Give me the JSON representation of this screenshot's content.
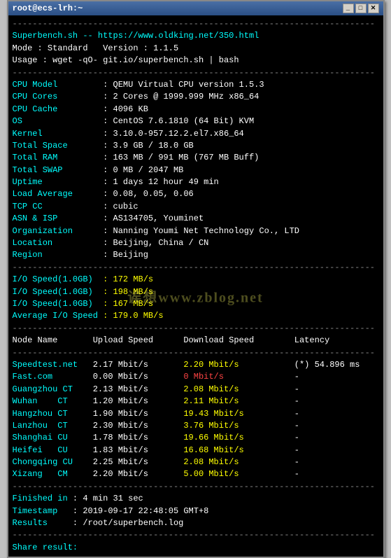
{
  "window": {
    "title": "root@ecs-lrh:~",
    "minimize_label": "_",
    "maximize_label": "□",
    "close_label": "✕"
  },
  "terminal": {
    "separator": "------------------------------------------------------------------------",
    "header": {
      "line1": "Superbench.sh -- https://www.oldking.net/350.html",
      "line2": "Mode : Standard   Version : 1.1.5",
      "line3": "Usage : wget -qO- git.io/superbench.sh | bash"
    },
    "system_info": [
      {
        "key": "CPU Model",
        "value": ": QEMU Virtual CPU version 1.5.3"
      },
      {
        "key": "CPU Cores",
        "value": ": 2 Cores @ 1999.999 MHz x86_64"
      },
      {
        "key": "CPU Cache",
        "value": ": 4096 KB"
      },
      {
        "key": "OS",
        "value": ": CentOS 7.6.1810 (64 Bit) KVM"
      },
      {
        "key": "Kernel",
        "value": ": 3.10.0-957.12.2.el7.x86_64"
      },
      {
        "key": "Total Space",
        "value": ": 3.9 GB / 18.0 GB"
      },
      {
        "key": "Total RAM",
        "value": ": 163 MB / 991 MB (767 MB Buff)"
      },
      {
        "key": "Total SWAP",
        "value": ": 0 MB / 2047 MB"
      },
      {
        "key": "Uptime",
        "value": ": 1 days 12 hour 49 min"
      },
      {
        "key": "Load Average",
        "value": ": 0.08, 0.05, 0.06"
      },
      {
        "key": "TCP CC",
        "value": ": cubic"
      },
      {
        "key": "ASN & ISP",
        "value": ": AS134705, Youminet"
      },
      {
        "key": "Organization",
        "value": ": Nanning Youmi Net Technology Co., LTD"
      },
      {
        "key": "Location",
        "value": ": Beijing, China / CN"
      },
      {
        "key": "Region",
        "value": ": Beijing"
      }
    ],
    "io_speeds": [
      {
        "key": "I/O Speed(1.0GB)",
        "value": ": 172 MB/s"
      },
      {
        "key": "I/O Speed(1.0GB)",
        "value": ": 198 MB/s"
      },
      {
        "key": "I/O Speed(1.0GB)",
        "value": ": 167 MB/s"
      },
      {
        "key": "Average I/O Speed",
        "value": ": 179.0 MB/s"
      }
    ],
    "network_header": "Node Name       Upload Speed      Download Speed        Latency",
    "network_nodes": [
      {
        "name": "Speedtest.net",
        "upload": "2.17 Mbit/s",
        "download": "2.20 Mbit/s",
        "latency": "(*) 54.896 ms"
      },
      {
        "name": "Fast.com",
        "upload": "0.00 Mbit/s",
        "download": "0 Mbit/s",
        "latency": "-"
      },
      {
        "name": "Guangzhou CT",
        "upload": "2.13 Mbit/s",
        "download": "2.08 Mbit/s",
        "latency": "-"
      },
      {
        "name": "Wuhan    CT",
        "upload": "1.20 Mbit/s",
        "download": "2.11 Mbit/s",
        "latency": "-"
      },
      {
        "name": "Hangzhou CT",
        "upload": "1.90 Mbit/s",
        "download": "19.43 Mbit/s",
        "latency": "-"
      },
      {
        "name": "Lanzhou  CT",
        "upload": "2.30 Mbit/s",
        "download": "3.76 Mbit/s",
        "latency": "-"
      },
      {
        "name": "Shanghai CU",
        "upload": "1.78 Mbit/s",
        "download": "19.66 Mbit/s",
        "latency": "-"
      },
      {
        "name": "Heifei   CU",
        "upload": "1.83 Mbit/s",
        "download": "16.68 Mbit/s",
        "latency": "-"
      },
      {
        "name": "Chongqing CU",
        "upload": "2.25 Mbit/s",
        "download": "2.08 Mbit/s",
        "latency": "-"
      },
      {
        "name": "Xizang   CM",
        "upload": "2.20 Mbit/s",
        "download": "5.00 Mbit/s",
        "latency": "-"
      }
    ],
    "footer": {
      "finished": "Finished in : 4 min 31 sec",
      "timestamp": "Timestamp   : 2019-09-17 22:48:05 GMT+8",
      "results": "Results     : /root/superbench.log",
      "share": "Share result:"
    },
    "watermark": "诶想www.zblog.net"
  }
}
